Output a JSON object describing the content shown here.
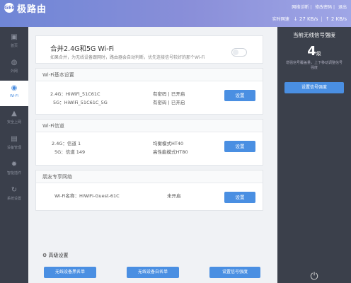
{
  "header": {
    "logo_text": "GEE",
    "brand": "极路由",
    "links": [
      "网络诊断",
      "修改密码",
      "退出"
    ],
    "speed_label": "实时网速",
    "down_speed": "27 KB/s",
    "up_speed": "2 KB/s"
  },
  "nav": [
    {
      "icon": "▣",
      "label": "首页"
    },
    {
      "icon": "◍",
      "label": "外网"
    },
    {
      "icon": "◉",
      "label": "Wi-Fi"
    },
    {
      "icon": "▲",
      "label": "安全上网"
    },
    {
      "icon": "▤",
      "label": "设备管理"
    },
    {
      "icon": "✹",
      "label": "智能插件"
    },
    {
      "icon": "↻",
      "label": "系统设置"
    }
  ],
  "merge": {
    "title": "合并2.4G和5G Wi-Fi",
    "desc": "如果合并，为无线设备跟网时，路由器会自动判断，优先连接信号较好的那个Wi-Fi"
  },
  "wifi_basic": {
    "title": "Wi-Fi基本设置",
    "rows": [
      {
        "band": "2.4G：",
        "ssid": "HiWiFi_51C61C",
        "status": "有密码 | 已开启"
      },
      {
        "band": "5G：",
        "ssid": "HiWiFi_51C61C_5G",
        "status": "有密码 | 已开启"
      }
    ],
    "button": "设置"
  },
  "wifi_channel": {
    "title": "Wi-Fi信道",
    "rows": [
      {
        "band": "2.4G：",
        "channel": "信道 1",
        "mode": "均衡模式HT40"
      },
      {
        "band": "5G：",
        "channel": "信道 149",
        "mode": "高性能模式HT80"
      }
    ],
    "button": "设置"
  },
  "guest": {
    "title": "朋友专享网络",
    "name_label": "Wi-Fi名称：",
    "ssid": "HiWiFi-Guest-61C",
    "status": "未开启",
    "button": "设置"
  },
  "advanced": {
    "title": "⚙ 高级设置",
    "buttons": [
      "无线设备黑名单",
      "无线设备白名单",
      "设置信号强度"
    ]
  },
  "right_panel": {
    "title": "当前无线信号强度",
    "level": "4",
    "level_unit": "级",
    "desc": "增强信号覆盖量，上下移动调整信号强度",
    "button": "设置信号强度",
    "power_icon": "⏻"
  }
}
